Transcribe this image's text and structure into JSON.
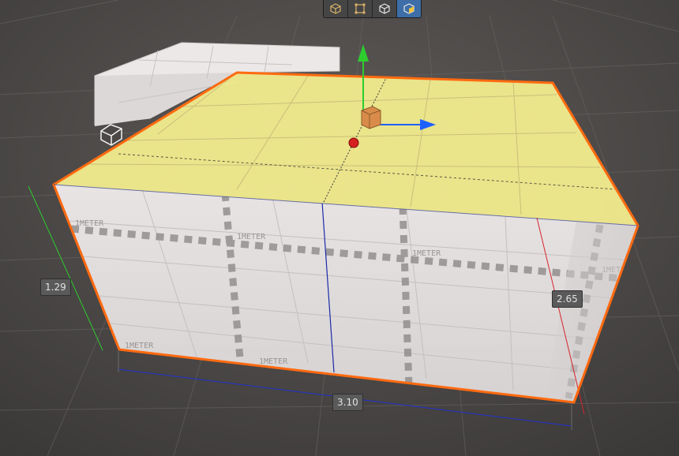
{
  "toolbar": {
    "tools": [
      {
        "name": "object-mode",
        "active": false
      },
      {
        "name": "rect-select-mode",
        "active": false
      },
      {
        "name": "vertex-mode",
        "active": false
      },
      {
        "name": "face-mode",
        "active": true
      }
    ]
  },
  "dimensions": {
    "height": "1.29",
    "depth": "2.65",
    "width": "3.10"
  },
  "texture_text": "1METER",
  "colors": {
    "selection_outline": "#ff6a10",
    "selected_face": "#f2ec8e",
    "axis_x": "#e02020",
    "axis_y": "#2ecc2e",
    "axis_z": "#1e60ff"
  }
}
